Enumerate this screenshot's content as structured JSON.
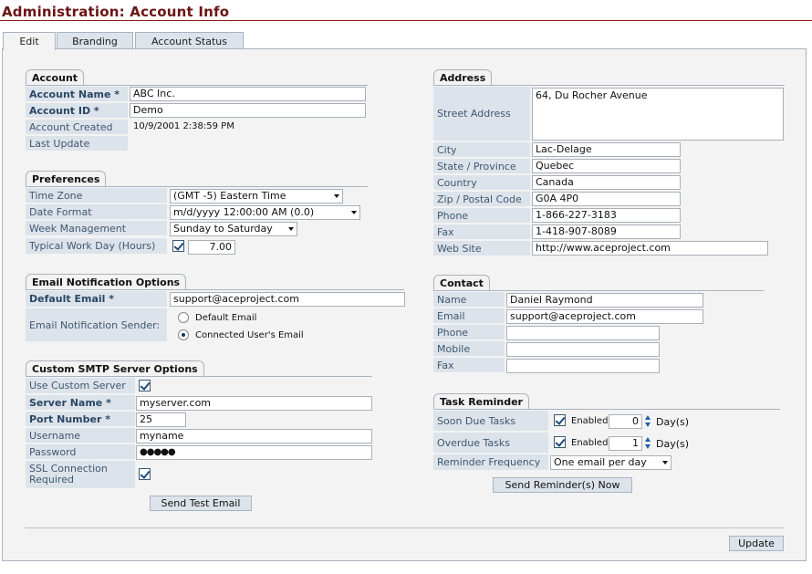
{
  "page_title": "Administration: Account Info",
  "tabs": [
    {
      "label": "Edit"
    },
    {
      "label": "Branding"
    },
    {
      "label": "Account Status"
    }
  ],
  "account": {
    "heading": "Account",
    "name_label": "Account Name *",
    "name_value": "ABC Inc.",
    "id_label": "Account ID *",
    "id_value": "Demo",
    "created_label": "Account Created",
    "created_value": "10/9/2001 2:38:59 PM",
    "update_label": "Last Update",
    "update_value": ""
  },
  "preferences": {
    "heading": "Preferences",
    "timezone_label": "Time Zone",
    "timezone_value": "(GMT -5) Eastern Time",
    "dateformat_label": "Date Format",
    "dateformat_value": "m/d/yyyy 12:00:00 AM (0.0)",
    "week_label": "Week Management",
    "week_value": "Sunday to Saturday",
    "workday_label": "Typical Work Day (Hours)",
    "workday_checked": true,
    "workday_value": "7.00"
  },
  "email_notification": {
    "heading": "Email Notification Options",
    "default_label": "Default Email *",
    "default_value": "support@aceproject.com",
    "sender_label": "Email Notification Sender:",
    "options": [
      {
        "label": "Default Email",
        "selected": false
      },
      {
        "label": "Connected User's Email",
        "selected": true
      }
    ]
  },
  "smtp": {
    "heading": "Custom SMTP Server Options",
    "use_custom_label": "Use Custom Server",
    "use_custom_checked": true,
    "server_label": "Server Name *",
    "server_value": "myserver.com",
    "port_label": "Port Number *",
    "port_value": "25",
    "username_label": "Username",
    "username_value": "myname",
    "password_label": "Password",
    "password_value": "●●●●●",
    "ssl_label_line1": "SSL Connection",
    "ssl_label_line2": "Required",
    "ssl_checked": true,
    "test_button": "Send Test Email"
  },
  "address": {
    "heading": "Address",
    "street_label": "Street Address",
    "street_value": "64, Du Rocher Avenue",
    "city_label": "City",
    "city_value": "Lac-Delage",
    "state_label": "State / Province",
    "state_value": "Quebec",
    "country_label": "Country",
    "country_value": "Canada",
    "zip_label": "Zip / Postal Code",
    "zip_value": "G0A 4P0",
    "phone_label": "Phone",
    "phone_value": "1-866-227-3183",
    "fax_label": "Fax",
    "fax_value": "1-418-907-8089",
    "web_label": "Web Site",
    "web_value": "http://www.aceproject.com"
  },
  "contact": {
    "heading": "Contact",
    "name_label": "Name",
    "name_value": "Daniel Raymond",
    "email_label": "Email",
    "email_value": "support@aceproject.com",
    "phone_label": "Phone",
    "phone_value": "",
    "mobile_label": "Mobile",
    "mobile_value": "",
    "fax_label": "Fax",
    "fax_value": ""
  },
  "task_reminder": {
    "heading": "Task Reminder",
    "soon_label": "Soon Due Tasks",
    "soon_enabled": true,
    "soon_enabled_label": "Enabled",
    "soon_days": "0",
    "soon_days_suffix": "Day(s)",
    "overdue_label": "Overdue Tasks",
    "overdue_enabled": true,
    "overdue_enabled_label": "Enabled",
    "overdue_days": "1",
    "overdue_days_suffix": "Day(s)",
    "frequency_label": "Reminder Frequency",
    "frequency_value": "One email per day",
    "send_button": "Send Reminder(s) Now"
  },
  "footer": {
    "update_button": "Update"
  },
  "colors": {
    "title": "#6b1414",
    "label_bg": "#dde3ea",
    "label_text": "#3e5770",
    "panel_bg": "#f3f3f3",
    "border": "#a8b3c0"
  }
}
